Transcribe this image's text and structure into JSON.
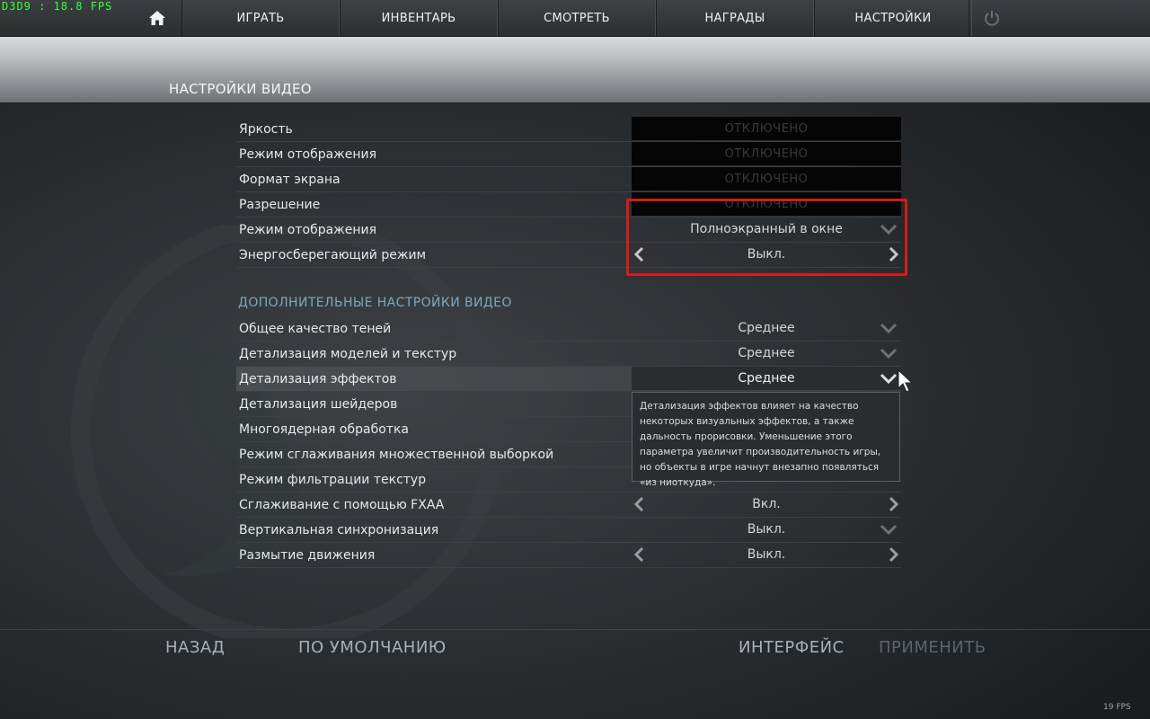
{
  "overlay": {
    "fps_text": "D3D9  :  18.8 FPS"
  },
  "nav": {
    "items": [
      {
        "label": "ИГРАТЬ"
      },
      {
        "label": "ИНВЕНТАРЬ"
      },
      {
        "label": "СМОТРЕТЬ"
      },
      {
        "label": "НАГРАДЫ"
      },
      {
        "label": "НАСТРОЙКИ"
      }
    ],
    "home_icon": "home-icon",
    "power_icon": "power-icon"
  },
  "page": {
    "title": "НАСТРОЙКИ ВИДЕО"
  },
  "basic": {
    "rows": [
      {
        "label": "Яркость",
        "value": "ОТКЛЮЧЕНО",
        "control": "disabled"
      },
      {
        "label": "Режим отображения",
        "value": "ОТКЛЮЧЕНО",
        "control": "disabled"
      },
      {
        "label": "Формат экрана",
        "value": "ОТКЛЮЧЕНО",
        "control": "disabled"
      },
      {
        "label": "Разрешение",
        "value": "ОТКЛЮЧЕНО",
        "control": "disabled"
      },
      {
        "label": "Режим отображения",
        "value": "Полноэкранный в окне",
        "control": "dropdown"
      },
      {
        "label": "Энергосберегающий режим",
        "value": "Выкл.",
        "control": "arrows"
      }
    ]
  },
  "advanced": {
    "title": "ДОПОЛНИТЕЛЬНЫЕ НАСТРОЙКИ ВИДЕО",
    "rows": [
      {
        "label": "Общее качество теней",
        "value": "Среднее",
        "control": "dropdown"
      },
      {
        "label": "Детализация моделей и текстур",
        "value": "Среднее",
        "control": "dropdown"
      },
      {
        "label": "Детализация эффектов",
        "value": "Среднее",
        "control": "dropdown"
      },
      {
        "label": "Детализация шейдеров",
        "value": "",
        "control": "dropdown"
      },
      {
        "label": "Многоядерная обработка",
        "value": "",
        "control": "dropdown"
      },
      {
        "label": "Режим сглаживания множественной выборкой",
        "value": "",
        "control": "dropdown"
      },
      {
        "label": "Режим фильтрации текстур",
        "value": "",
        "control": "dropdown"
      },
      {
        "label": "Сглаживание с помощью FXAA",
        "value": "Вкл.",
        "control": "arrows"
      },
      {
        "label": "Вертикальная синхронизация",
        "value": "Выкл.",
        "control": "dropdown"
      },
      {
        "label": "Размытие движения",
        "value": "Выкл.",
        "control": "arrows"
      }
    ]
  },
  "tooltip": {
    "text": "Детализация эффектов влияет на качество некоторых визуальных эффектов, а также дальность прорисовки. Уменьшение этого параметра увеличит производительность игры, но объекты в игре начнут внезапно появляться «из ниоткуда»."
  },
  "footer": {
    "back": "НАЗАД",
    "defaults": "ПО УМОЛЧАНИЮ",
    "interface": "ИНТЕРФЕЙС",
    "apply": "ПРИМЕНИТЬ",
    "fps": "19 FPS"
  },
  "colors": {
    "highlight_box": "#d81a1a",
    "section_title": "#7fa7c0",
    "fps_overlay": "#3bff3b"
  }
}
